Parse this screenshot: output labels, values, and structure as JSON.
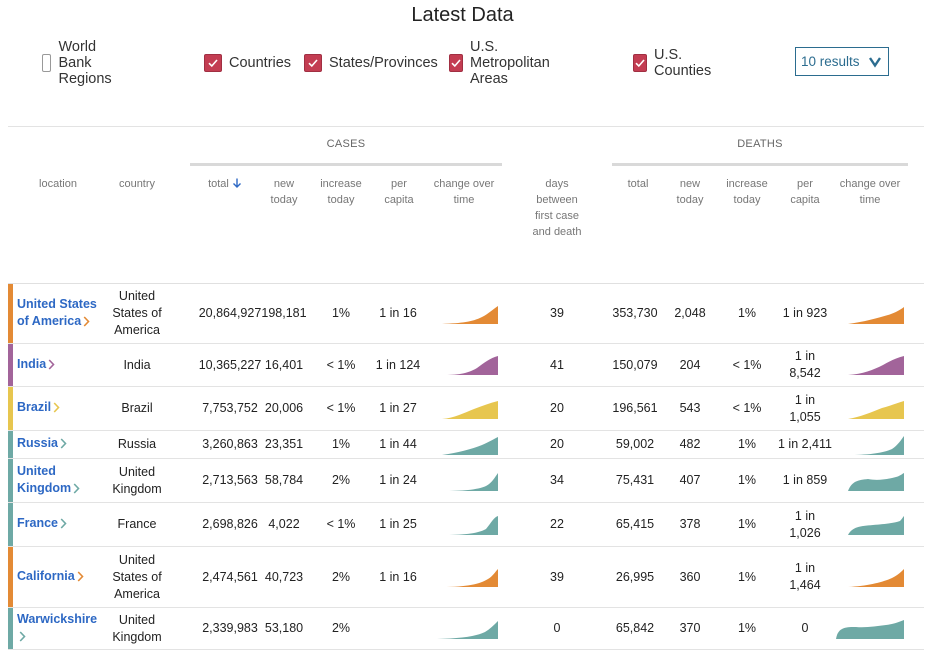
{
  "page": {
    "title": "Latest Data"
  },
  "filters": [
    {
      "label": "World Bank Regions",
      "checked": false
    },
    {
      "label": "Countries",
      "checked": true
    },
    {
      "label": "States/Provinces",
      "checked": true
    },
    {
      "label": "U.S. Metropolitan Areas",
      "checked": true
    },
    {
      "label": "U.S. Counties",
      "checked": true
    }
  ],
  "results": {
    "label": "10 results"
  },
  "groups": {
    "cases": "CASES",
    "deaths": "DEATHS"
  },
  "columns": {
    "location": "location",
    "country": "country",
    "cases_total": "total",
    "cases_new": "new today",
    "cases_increase": "increase today",
    "cases_per_capita": "per capita",
    "cases_change": "change over time",
    "days_between": "days between first case and death",
    "deaths_total": "total",
    "deaths_new": "new today",
    "deaths_increase": "increase today",
    "deaths_per_capita": "per capita",
    "deaths_change": "change over time"
  },
  "colors": {
    "orange": "#e38a35",
    "purple": "#a2649a",
    "yellow": "#e7c64f",
    "teal": "#6ea9a5",
    "link": "#2d68c4",
    "checkbox": "#c33d52",
    "results": "#2b6c8f"
  },
  "rows": [
    {
      "location": "United States of America",
      "country": "United States of America",
      "cases_total": "20,864,927",
      "cases_new": "198,181",
      "cases_increase": "1%",
      "cases_per_capita": "1 in 16",
      "days": "39",
      "deaths_total": "353,730",
      "deaths_new": "2,048",
      "deaths_increase": "1%",
      "deaths_per_capita": "1 in 923",
      "color": "#e38a35"
    },
    {
      "location": "India",
      "country": "India",
      "cases_total": "10,365,227",
      "cases_new": "16,401",
      "cases_increase": "< 1%",
      "cases_per_capita": "1 in 124",
      "days": "41",
      "deaths_total": "150,079",
      "deaths_new": "204",
      "deaths_increase": "< 1%",
      "deaths_per_capita": "1 in 8,542",
      "color": "#a2649a"
    },
    {
      "location": "Brazil",
      "country": "Brazil",
      "cases_total": "7,753,752",
      "cases_new": "20,006",
      "cases_increase": "< 1%",
      "cases_per_capita": "1 in 27",
      "days": "20",
      "deaths_total": "196,561",
      "deaths_new": "543",
      "deaths_increase": "< 1%",
      "deaths_per_capita": "1 in 1,055",
      "color": "#e7c64f"
    },
    {
      "location": "Russia",
      "country": "Russia",
      "cases_total": "3,260,863",
      "cases_new": "23,351",
      "cases_increase": "1%",
      "cases_per_capita": "1 in 44",
      "days": "20",
      "deaths_total": "59,002",
      "deaths_new": "482",
      "deaths_increase": "1%",
      "deaths_per_capita": "1 in 2,411",
      "color": "#6ea9a5"
    },
    {
      "location": "United Kingdom",
      "country": "United Kingdom",
      "cases_total": "2,713,563",
      "cases_new": "58,784",
      "cases_increase": "2%",
      "cases_per_capita": "1 in 24",
      "days": "34",
      "deaths_total": "75,431",
      "deaths_new": "407",
      "deaths_increase": "1%",
      "deaths_per_capita": "1 in 859",
      "color": "#6ea9a5"
    },
    {
      "location": "France",
      "country": "France",
      "cases_total": "2,698,826",
      "cases_new": "4,022",
      "cases_increase": "< 1%",
      "cases_per_capita": "1 in 25",
      "days": "22",
      "deaths_total": "65,415",
      "deaths_new": "378",
      "deaths_increase": "1%",
      "deaths_per_capita": "1 in 1,026",
      "color": "#6ea9a5"
    },
    {
      "location": "California",
      "country": "United States of America",
      "cases_total": "2,474,561",
      "cases_new": "40,723",
      "cases_increase": "2%",
      "cases_per_capita": "1 in 16",
      "days": "39",
      "deaths_total": "26,995",
      "deaths_new": "360",
      "deaths_increase": "1%",
      "deaths_per_capita": "1 in 1,464",
      "color": "#e38a35"
    },
    {
      "location": "Warwickshire",
      "country": "United Kingdom",
      "cases_total": "2,339,983",
      "cases_new": "53,180",
      "cases_increase": "2%",
      "cases_per_capita": "",
      "days": "0",
      "deaths_total": "65,842",
      "deaths_new": "370",
      "deaths_increase": "1%",
      "deaths_per_capita": "0",
      "color": "#6ea9a5"
    }
  ]
}
